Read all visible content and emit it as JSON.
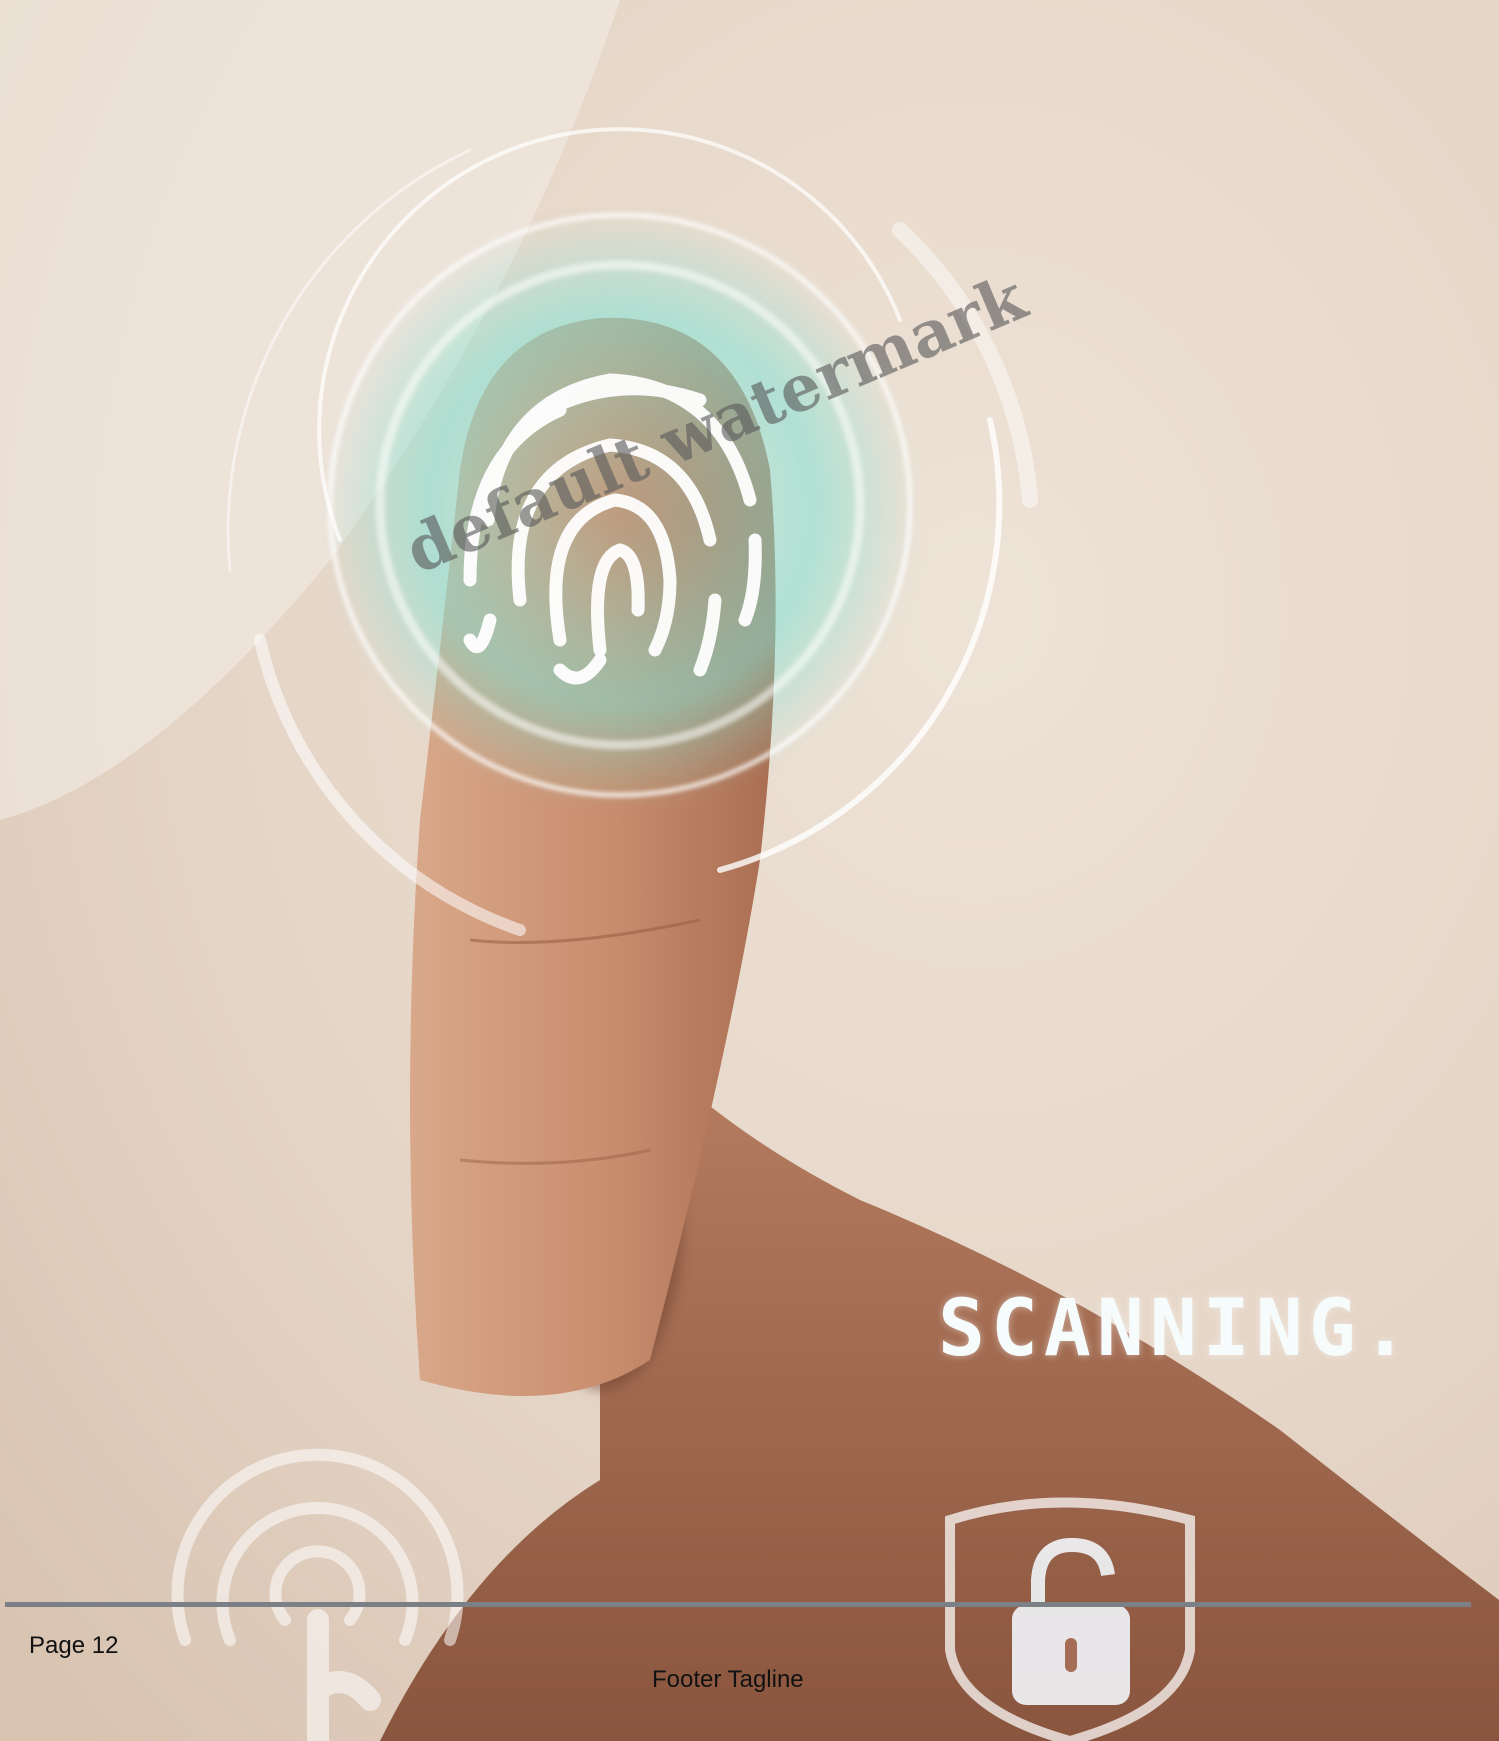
{
  "photo": {
    "overlay_text": "SCANNING.",
    "colors": {
      "background": "#e9dccf",
      "skin": "#c98f6f",
      "glow": "#7fe3d6",
      "hud": "#ffffff"
    }
  },
  "watermark": {
    "text": "default watermark"
  },
  "footer": {
    "page_label": "Page 12",
    "tagline": "Footer Tagline"
  }
}
